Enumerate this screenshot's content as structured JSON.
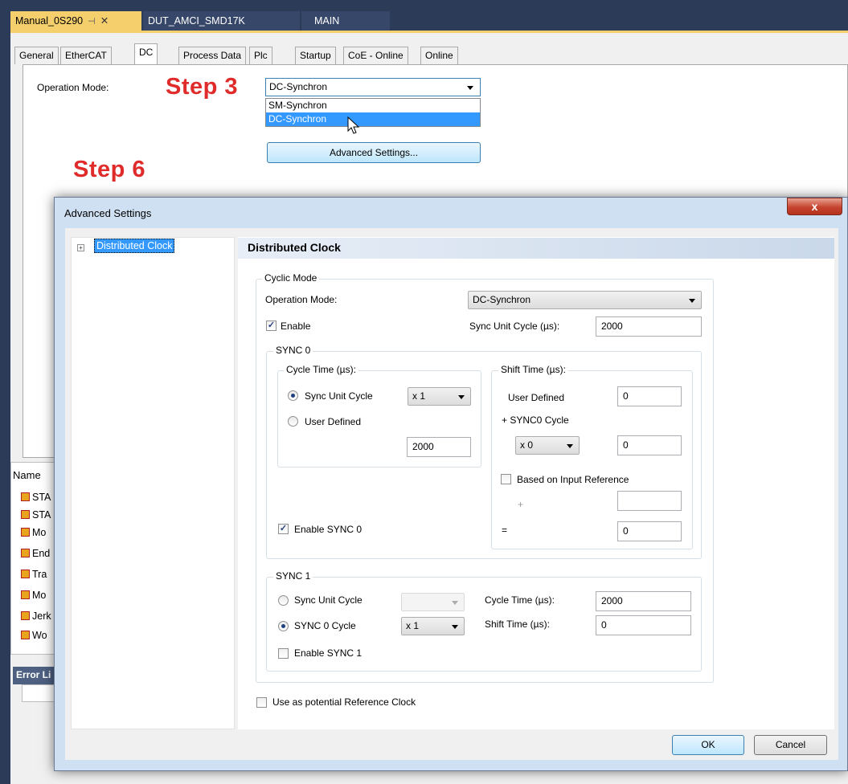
{
  "doc_tabs": {
    "active": "Manual_0S290",
    "active_pin": "⊣",
    "active_close": "✕",
    "tab2": "DUT_AMCI_SMD17K",
    "tab3": "MAIN"
  },
  "prop_tabs": [
    "General",
    "EtherCAT",
    "DC",
    "Process Data",
    "Plc",
    "Startup",
    "CoE - Online",
    "Online"
  ],
  "dc_panel": {
    "operation_mode_label": "Operation Mode:",
    "selected": "DC-Synchron",
    "options": [
      "SM-Synchron",
      "DC-Synchron"
    ],
    "advanced_button": "Advanced Settings..."
  },
  "annotations": {
    "step3": "Step 3",
    "step6": "Step 6"
  },
  "name_panel": {
    "header": "Name",
    "rows": [
      "STA",
      "STA",
      "Mo",
      "End",
      "Tra",
      "Mo",
      "Jerk",
      "Wo"
    ]
  },
  "error_panel": {
    "header": "Error Li"
  },
  "dialog": {
    "title": "Advanced Settings",
    "close_glyph": "x",
    "tree_item": "Distributed Clock",
    "tree_expander": "+",
    "pane_header": "Distributed Clock",
    "cyclic_mode": {
      "title": "Cyclic Mode",
      "operation_mode_label": "Operation Mode:",
      "operation_mode_value": "DC-Synchron",
      "enable_label": "Enable",
      "enable_checked": true,
      "sync_unit_cycle_label": "Sync Unit Cycle (µs):",
      "sync_unit_cycle_value": "2000"
    },
    "sync0": {
      "title": "SYNC 0",
      "cycle_time_title": "Cycle Time (µs):",
      "radio_sync_unit": "Sync Unit Cycle",
      "radio_user_defined": "User Defined",
      "multiplier": "x 1",
      "user_defined_value": "2000",
      "shift_time_title": "Shift Time (µs):",
      "shift_user_defined_label": "User Defined",
      "shift_user_defined_value": "0",
      "plus_sync0_label": "+ SYNC0 Cycle",
      "plus_multiplier": "x 0",
      "plus_value": "0",
      "based_on_input_label": "Based on Input Reference",
      "plus_sign": "+",
      "plus_input_value": "",
      "equals_sign": "=",
      "result_value": "0",
      "enable_label": "Enable SYNC 0",
      "enable_checked": true
    },
    "sync1": {
      "title": "SYNC 1",
      "radio_sync_unit": "Sync Unit Cycle",
      "radio_sync0_cycle": "SYNC 0 Cycle",
      "multiplier": "x 1",
      "cycle_time_label": "Cycle Time (µs):",
      "cycle_time_value": "2000",
      "shift_time_label": "Shift Time (µs):",
      "shift_time_value": "0",
      "enable_label": "Enable SYNC 1",
      "enable_checked": false
    },
    "reference_clock_label": "Use as potential Reference Clock",
    "ok_button": "OK",
    "cancel_button": "Cancel"
  }
}
